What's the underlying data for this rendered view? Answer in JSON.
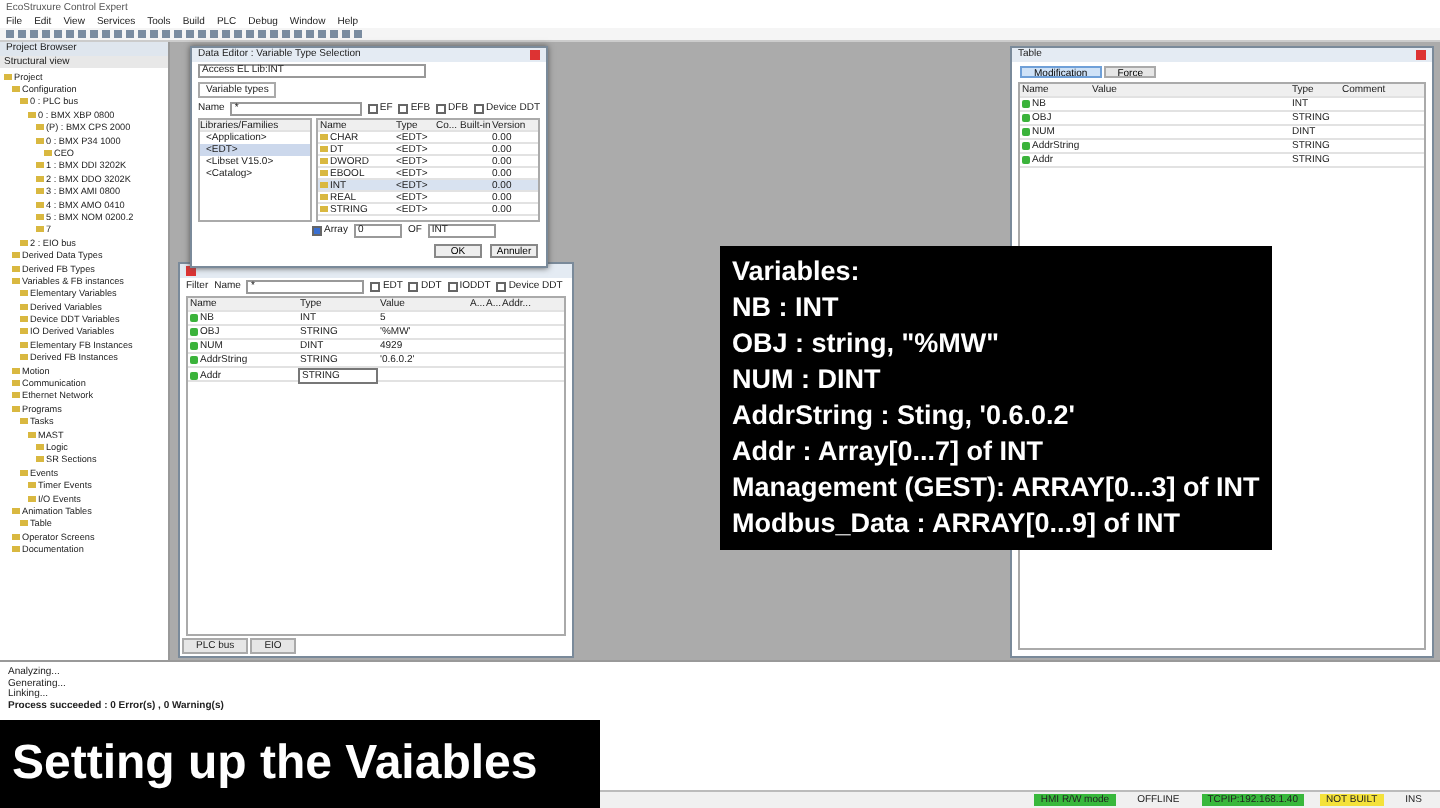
{
  "window": {
    "title": "EcoStruxure Control Expert"
  },
  "menu": [
    "File",
    "Edit",
    "View",
    "Services",
    "Tools",
    "Build",
    "PLC",
    "Debug",
    "Window",
    "Help"
  ],
  "project_browser": {
    "title": "Project Browser",
    "view": "Structural view",
    "tree": [
      {
        "label": "Project",
        "children": [
          {
            "label": "Configuration",
            "children": [
              {
                "label": "0 : PLC bus",
                "children": [
                  {
                    "label": "0 : BMX XBP 0800",
                    "children": [
                      {
                        "label": "(P) : BMX CPS 2000"
                      },
                      {
                        "label": "0 : BMX P34 1000",
                        "children": [
                          {
                            "label": "CEO"
                          }
                        ]
                      },
                      {
                        "label": "1 : BMX DDI 3202K"
                      },
                      {
                        "label": "2 : BMX DDO 3202K"
                      },
                      {
                        "label": "3 : BMX AMI 0800"
                      },
                      {
                        "label": "4 : BMX AMO 0410"
                      },
                      {
                        "label": "5 : BMX NOM 0200.2"
                      },
                      {
                        "label": "7"
                      }
                    ]
                  }
                ]
              },
              {
                "label": "2 : EIO bus"
              }
            ]
          },
          {
            "label": "Derived Data Types"
          },
          {
            "label": "Derived FB Types"
          },
          {
            "label": "Variables & FB instances",
            "children": [
              {
                "label": "Elementary Variables"
              },
              {
                "label": "Derived Variables"
              },
              {
                "label": "Device DDT Variables"
              },
              {
                "label": "IO Derived Variables"
              },
              {
                "label": "Elementary FB Instances"
              },
              {
                "label": "Derived FB Instances"
              }
            ]
          },
          {
            "label": "Motion"
          },
          {
            "label": "Communication"
          },
          {
            "label": "Ethernet Network"
          },
          {
            "label": "Programs",
            "children": [
              {
                "label": "Tasks",
                "children": [
                  {
                    "label": "MAST",
                    "children": [
                      {
                        "label": "Logic"
                      },
                      {
                        "label": "SR Sections"
                      }
                    ]
                  }
                ]
              },
              {
                "label": "Events",
                "children": [
                  {
                    "label": "Timer Events"
                  },
                  {
                    "label": "I/O Events"
                  }
                ]
              }
            ]
          },
          {
            "label": "Animation Tables",
            "children": [
              {
                "label": "Table"
              }
            ]
          },
          {
            "label": "Operator Screens"
          },
          {
            "label": "Documentation"
          }
        ]
      }
    ]
  },
  "dialog": {
    "title": "Data Editor : Variable Type Selection",
    "library": "Access EL Lib:INT",
    "tab": "Variable types",
    "name_label": "Name",
    "name_value": "*",
    "filters": [
      {
        "label": "EF",
        "checked": false
      },
      {
        "label": "EFB",
        "checked": false
      },
      {
        "label": "DFB",
        "checked": false
      },
      {
        "label": "Device DDT",
        "checked": false
      }
    ],
    "families_header": "Libraries/Families",
    "families": [
      {
        "label": "<Application>",
        "selected": false
      },
      {
        "label": "<EDT>",
        "selected": true
      },
      {
        "label": "<Libset V15.0>",
        "selected": false
      },
      {
        "label": "<Catalog>",
        "selected": false
      }
    ],
    "columns": [
      "Name",
      "Type",
      "Co...",
      "Built-in",
      "Version"
    ],
    "rows": [
      {
        "name": "CHAR",
        "type": "<EDT>",
        "builtin": "",
        "version": "0.00",
        "selected": false
      },
      {
        "name": "DT",
        "type": "<EDT>",
        "builtin": "",
        "version": "0.00",
        "selected": false
      },
      {
        "name": "DWORD",
        "type": "<EDT>",
        "builtin": "",
        "version": "0.00",
        "selected": false
      },
      {
        "name": "EBOOL",
        "type": "<EDT>",
        "builtin": "",
        "version": "0.00",
        "selected": false
      },
      {
        "name": "INT",
        "type": "<EDT>",
        "builtin": "",
        "version": "0.00",
        "selected": true
      },
      {
        "name": "REAL",
        "type": "<EDT>",
        "builtin": "",
        "version": "0.00",
        "selected": false
      },
      {
        "name": "STRING",
        "type": "<EDT>",
        "builtin": "",
        "version": "0.00",
        "selected": false
      }
    ],
    "array": {
      "label": "Array",
      "checked": true,
      "from": "0",
      "of_label": "OF",
      "of_type": "INT"
    },
    "buttons": [
      "OK",
      "Annuler"
    ]
  },
  "variables": {
    "filter_label": "Filter",
    "name_label": "Name",
    "name_value": "*",
    "filters": [
      {
        "label": "EDT",
        "checked": false
      },
      {
        "label": "DDT",
        "checked": false
      },
      {
        "label": "IODDT",
        "checked": false
      },
      {
        "label": "Device DDT",
        "checked": false
      }
    ],
    "columns": [
      "Name",
      "Type",
      "Value",
      "A...",
      "A...",
      "Addr..."
    ],
    "rows": [
      {
        "name": "NB",
        "type": "INT",
        "value": "5",
        "editing": false
      },
      {
        "name": "OBJ",
        "type": "STRING",
        "value": "'%MW'",
        "editing": false
      },
      {
        "name": "NUM",
        "type": "DINT",
        "value": "4929",
        "editing": false
      },
      {
        "name": "AddrString",
        "type": "STRING",
        "value": "'0.6.0.2'",
        "editing": false
      },
      {
        "name": "Addr",
        "type": "STRING",
        "value": "",
        "editing": true
      }
    ],
    "tabs": [
      {
        "label": "PLC bus",
        "selected": false
      },
      {
        "label": "EIO",
        "selected": false
      }
    ]
  },
  "animation": {
    "title": "Table",
    "tabs": [
      {
        "label": "Modification",
        "selected": true
      },
      {
        "label": "Force",
        "selected": false
      }
    ],
    "columns": [
      "Name",
      "Value",
      "Type",
      "Comment"
    ],
    "rows": [
      {
        "name": "NB",
        "type": "INT"
      },
      {
        "name": "OBJ",
        "type": "STRING"
      },
      {
        "name": "NUM",
        "type": "DINT"
      },
      {
        "name": "AddrString",
        "type": "STRING"
      },
      {
        "name": "Addr",
        "type": "STRING"
      }
    ]
  },
  "notes": [
    "Variables:",
    "NB : INT",
    "OBJ : string, \"%MW\"",
    "NUM : DINT",
    "AddrString : Sting, '0.6.0.2'",
    "Addr : Array[0...7] of INT",
    "Management (GEST): ARRAY[0...3] of INT",
    "Modbus_Data : ARRAY[0...9] of INT"
  ],
  "output": [
    "Analyzing...",
    "Generating...",
    "Linking...",
    "Process succeeded : 0 Error(s) , 0 Warning(s)"
  ],
  "caption": "Setting up the Vaiables",
  "status_bar": [
    {
      "text": "HMI R/W mode",
      "kind": "green"
    },
    {
      "text": "OFFLINE",
      "kind": "plain"
    },
    {
      "text": "TCPIP:192.168.1.40",
      "kind": "green"
    },
    {
      "text": "NOT BUILT",
      "kind": "yellow"
    },
    {
      "text": "INS",
      "kind": "plain"
    }
  ]
}
